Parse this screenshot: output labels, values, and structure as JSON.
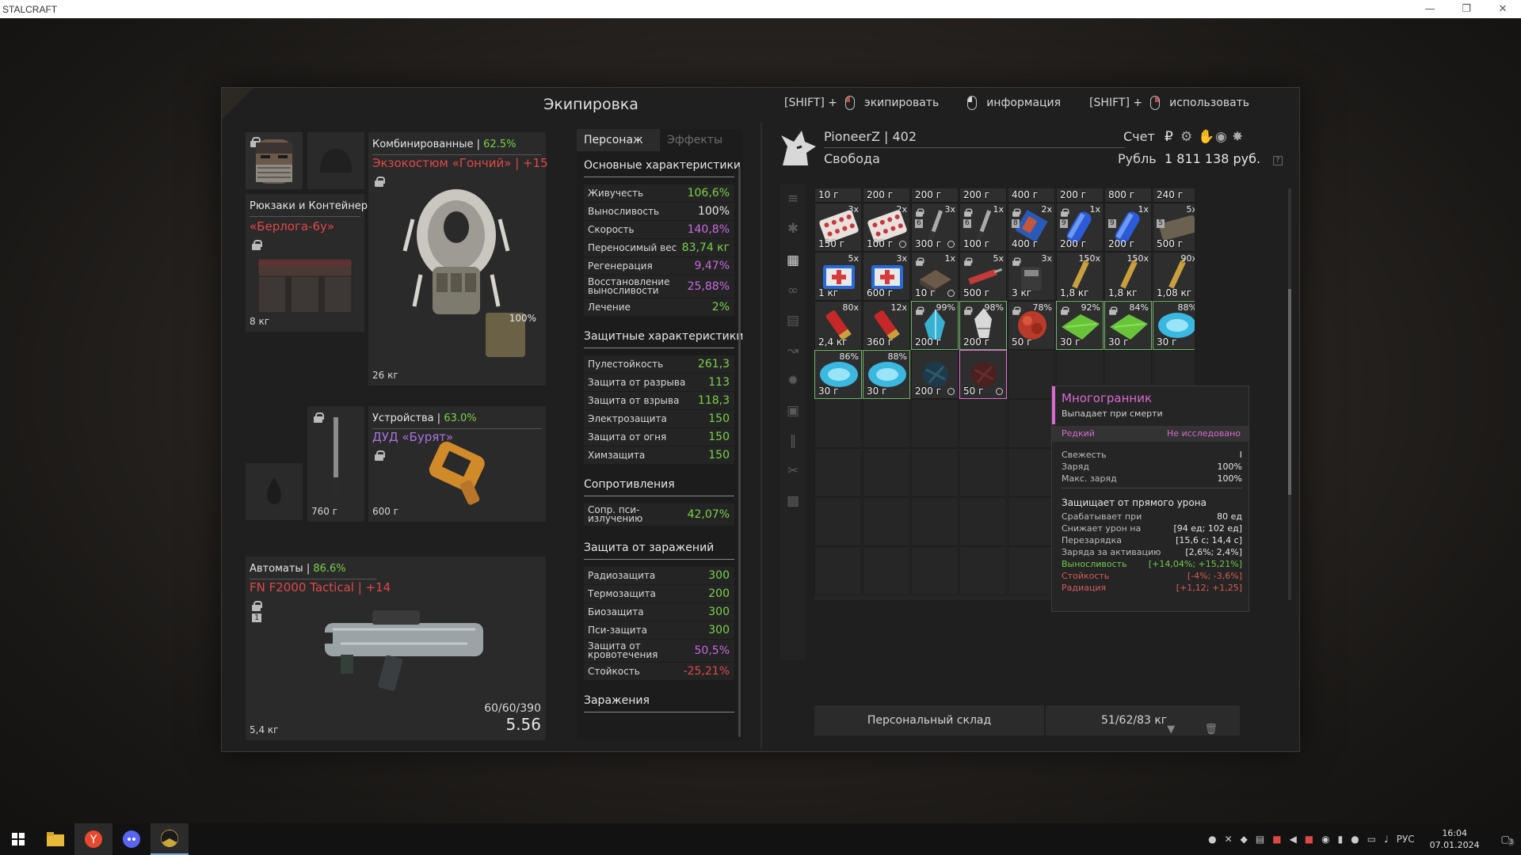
{
  "window": {
    "title": "STALCRAFT"
  },
  "panel_title": "Экипировка",
  "hints": [
    {
      "prefix": "[SHIFT] +",
      "label": "экипировать"
    },
    {
      "prefix": "",
      "label": "информация"
    },
    {
      "prefix": "[SHIFT] +",
      "label": "использовать"
    }
  ],
  "equipment": {
    "backpack": {
      "category": "Рюкзаки и Контейнеры",
      "name": "«Берлога-6у»",
      "weight": "8 кг"
    },
    "armor": {
      "category": "Комбинированные",
      "percent": "62.5%",
      "name": "Экзокостюм «Гончий» | +15",
      "weight": "26 кг",
      "durability": "100%"
    },
    "melee": {
      "weight": "760 г"
    },
    "device": {
      "category": "Устройства",
      "percent": "63.0%",
      "name": "ДУД «Бурят»",
      "weight": "600 г"
    },
    "weapon": {
      "category": "Автоматы",
      "percent": "86.6%",
      "name": "FN F2000 Tactical | +14",
      "weight": "5,4 кг",
      "ammo": "60/60/390",
      "caliber": "5.56",
      "slot_number": "1"
    }
  },
  "stats": {
    "tabs": [
      "Персонаж",
      "Эффекты"
    ],
    "basic_title": "Основные характеристики",
    "basic": [
      {
        "k": "Живучесть",
        "v": "106,6%"
      },
      {
        "k": "Выносливость",
        "v": "100%"
      },
      {
        "k": "Скорость",
        "v": "140,8%"
      },
      {
        "k": "Переносимый вес",
        "v": "83,74 кг"
      },
      {
        "k": "Регенерация",
        "v": "9,47%"
      },
      {
        "k": "Восстановление выносливости",
        "v": "25,88%"
      },
      {
        "k": "Лечение",
        "v": "2%"
      }
    ],
    "protect_title": "Защитные характеристики",
    "protect": [
      {
        "k": "Пулестойкость",
        "v": "261,3"
      },
      {
        "k": "Защита от разрыва",
        "v": "113"
      },
      {
        "k": "Защита от взрыва",
        "v": "118,3"
      },
      {
        "k": "Электрозащита",
        "v": "150"
      },
      {
        "k": "Защита от огня",
        "v": "150"
      },
      {
        "k": "Химзащита",
        "v": "150"
      }
    ],
    "resist_title": "Сопротивления",
    "resist": [
      {
        "k": "Сопр. пси-излучению",
        "v": "42,07%"
      }
    ],
    "infect_title": "Защита от заражений",
    "infect": [
      {
        "k": "Радиозащита",
        "v": "300"
      },
      {
        "k": "Термозащита",
        "v": "200"
      },
      {
        "k": "Биозащита",
        "v": "300"
      },
      {
        "k": "Пси-защита",
        "v": "300"
      },
      {
        "k": "Защита от кровотечения",
        "v": "50,5%"
      },
      {
        "k": "Стойкость",
        "v": "-25,21%"
      }
    ],
    "contam_title": "Заражения"
  },
  "player": {
    "name": "PioneerZ | 402",
    "faction": "Свобода",
    "account_label": "Счет",
    "currency_label": "Рубль",
    "money": "1 811 138 руб."
  },
  "inventory": {
    "top_row": [
      "10 г",
      "200 г",
      "200 г",
      "200 г",
      "400 г",
      "200 г",
      "800 г",
      "240 г"
    ],
    "rows": [
      [
        {
          "c": "3x",
          "w": "150 г",
          "t": "pills"
        },
        {
          "c": "2x",
          "w": "100 г",
          "t": "pills",
          "clk": true
        },
        {
          "c": "3x",
          "w": "300 г",
          "t": "knife",
          "clk": true,
          "lk": true,
          "nb": "6"
        },
        {
          "c": "1x",
          "w": "100 г",
          "t": "knife",
          "lk": true,
          "nb": "6"
        },
        {
          "c": "2x",
          "w": "400 г",
          "t": "blue",
          "lk": true,
          "nb": "8"
        },
        {
          "c": "1x",
          "w": "200 г",
          "t": "bluecyl",
          "lk": true,
          "nb": "9"
        },
        {
          "c": "1x",
          "w": "200 г",
          "t": "bluecyl",
          "nb": "9"
        },
        {
          "c": "5x",
          "w": "500 г",
          "t": "brown",
          "nb": "5"
        }
      ],
      [
        {
          "c": "5x",
          "w": "1 кг",
          "t": "medkit"
        },
        {
          "c": "3x",
          "w": "600 г",
          "t": "medkit"
        },
        {
          "c": "1x",
          "w": "10 г",
          "t": "box",
          "clk": true,
          "lk": true
        },
        {
          "c": "5x",
          "w": "500 г",
          "t": "syringe",
          "lk": true
        },
        {
          "c": "3x",
          "w": "3 кг",
          "t": "device",
          "lk": true
        },
        {
          "c": "150x",
          "w": "1,8 кг",
          "t": "ammo"
        },
        {
          "c": "150x",
          "w": "1,8 кг",
          "t": "ammo"
        },
        {
          "c": "90x",
          "w": "1,08 кг",
          "t": "ammo"
        }
      ],
      [
        {
          "c": "80x",
          "w": "2,4 кг",
          "t": "shell"
        },
        {
          "c": "12x",
          "w": "360 г",
          "t": "shell"
        },
        {
          "c": "99%",
          "w": "200 г",
          "t": "crystal",
          "lk": true
        },
        {
          "c": "98%",
          "w": "200 г",
          "t": "crystalw",
          "lk": true
        },
        {
          "c": "78%",
          "w": "50 г",
          "t": "redart",
          "lk": true
        },
        {
          "c": "92%",
          "w": "30 г",
          "t": "greenart",
          "lk": true
        },
        {
          "c": "84%",
          "w": "30 г",
          "t": "greenart",
          "lk": true
        },
        {
          "c": "88%",
          "w": "30 г",
          "t": "iceart"
        }
      ],
      [
        {
          "c": "86%",
          "w": "30 г",
          "t": "iceart"
        },
        {
          "c": "88%",
          "w": "30 г",
          "t": "iceart"
        },
        {
          "c": "",
          "w": "200 г",
          "t": "darkcrystal",
          "clk": true
        },
        {
          "c": "",
          "w": "50 г",
          "t": "darkred",
          "clk": true
        }
      ]
    ],
    "storage_label": "Персональный склад",
    "capacity": "51/62/83 кг"
  },
  "tooltip": {
    "name": "Многогранник",
    "subtitle": "Выпадает при смерти",
    "rarity": "Редкий",
    "status": "Не исследовано",
    "props": [
      {
        "k": "Свежесть",
        "v": "I"
      },
      {
        "k": "Заряд",
        "v": "100%"
      },
      {
        "k": "Макс. заряд",
        "v": "100%"
      }
    ],
    "section": "Защищает от прямого урона",
    "effects": [
      {
        "k": "Срабатывает при",
        "v": "80 ед",
        "c": ""
      },
      {
        "k": "Снижает урон на",
        "v": "[94 ед; 102 ед]",
        "c": ""
      },
      {
        "k": "Перезарядка",
        "v": "[15,6 с; 14,4 с]",
        "c": ""
      },
      {
        "k": "Заряда за активацию",
        "v": "[2,6%; 2,4%]",
        "c": ""
      },
      {
        "k": "Выносливость",
        "v": "[+14,04%; +15,21%]",
        "c": "g"
      },
      {
        "k": "Стойкость",
        "v": "[-4%; -3,6%]",
        "c": "r"
      },
      {
        "k": "Радиация",
        "v": "[+1,12; +1,25]",
        "c": "r"
      }
    ]
  },
  "taskbar": {
    "time": "16:04",
    "date": "07.01.2024",
    "lang": "РУС",
    "notif": "3"
  },
  "colors": {
    "accent_red": "#e04848",
    "accent_green": "#7ad24a",
    "accent_purple": "#a874e0",
    "tooltip_pink": "#d86ad0"
  }
}
